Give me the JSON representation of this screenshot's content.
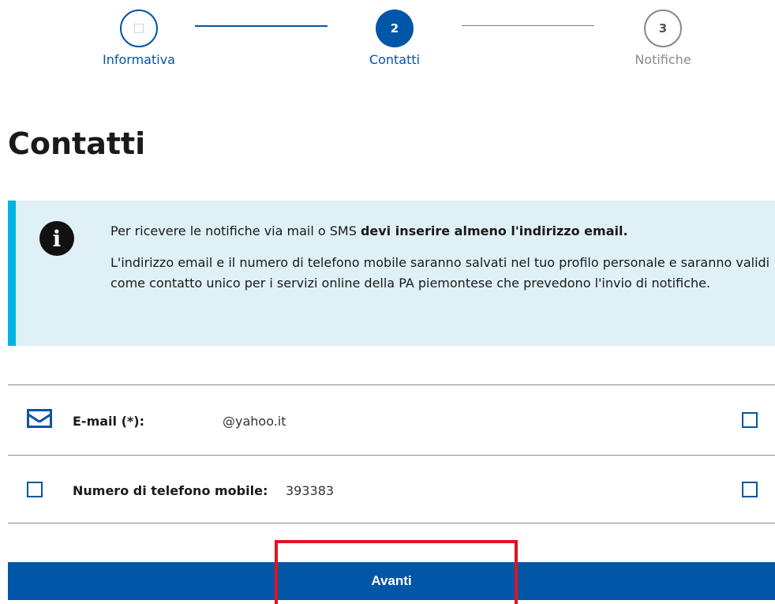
{
  "stepper": {
    "steps": [
      {
        "number": "",
        "label": "Informativa"
      },
      {
        "number": "2",
        "label": "Contatti"
      },
      {
        "number": "3",
        "label": "Notifiche"
      }
    ]
  },
  "page_title": "Contatti",
  "info": {
    "icon": "info-icon",
    "line1_prefix": "Per ricevere le notifiche via mail o SMS ",
    "line1_bold": "devi inserire almeno l'indirizzo email.",
    "paragraph2": "L'indirizzo email e il numero di telefono mobile saranno salvati nel tuo profilo personale e saranno validi come contatto unico per i servizi online della PA piemontese che prevedono l'invio di notifiche.",
    "accent_color": "#00b2e2",
    "background_color": "#dff0f6"
  },
  "contacts": {
    "email": {
      "label": "E-mail (*):",
      "value": "@yahoo.it",
      "icon": "mail-icon"
    },
    "phone": {
      "label": "Numero di telefono mobile:",
      "value": "393383"
    }
  },
  "next_button": {
    "label": "Avanti"
  },
  "colors": {
    "primary": "#0056a7",
    "highlight": "#e0121f"
  }
}
